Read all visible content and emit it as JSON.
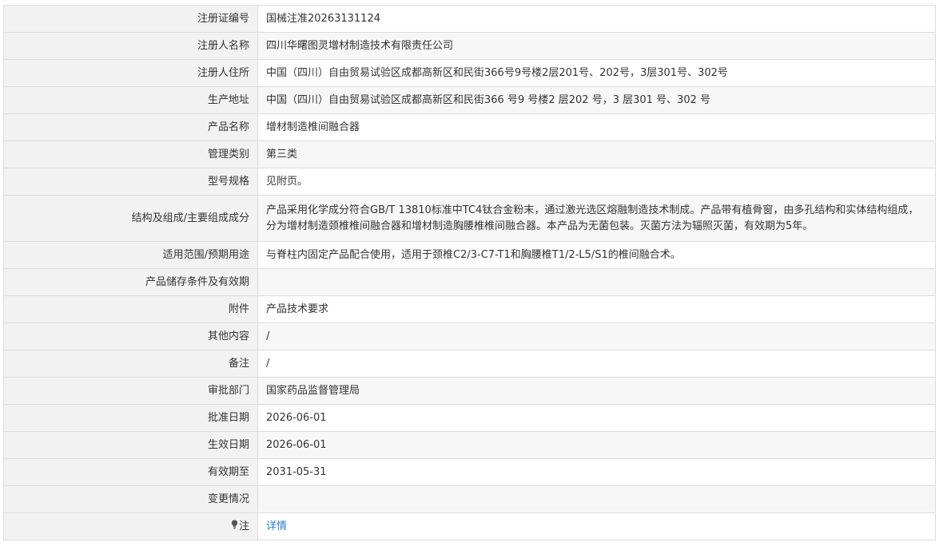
{
  "rows": [
    {
      "label": "注册证编号",
      "value": "国械注准20263131124"
    },
    {
      "label": "注册人名称",
      "value": "四川华曙图灵增材制造技术有限责任公司"
    },
    {
      "label": "注册人住所",
      "value": "中国（四川）自由贸易试验区成都高新区和民街366号9号楼2层201号、202号，3层301号、302号"
    },
    {
      "label": "生产地址",
      "value": "中国（四川）自由贸易试验区成都高新区和民街366 号9 号楼2 层202 号，3 层301 号、302 号"
    },
    {
      "label": "产品名称",
      "value": "增材制造椎间融合器"
    },
    {
      "label": "管理类别",
      "value": "第三类"
    },
    {
      "label": "型号规格",
      "value": "见附页。"
    },
    {
      "label": "结构及组成/主要组成成分",
      "value": "产品采用化学成分符合GB/T 13810标准中TC4钛合金粉末，通过激光选区熔融制造技术制成。产品带有植骨窗，由多孔结构和实体结构组成，分为增材制造颈椎椎间融合器和增材制造胸腰椎椎间融合器。本产品为无菌包装。灭菌方法为辐照灭菌，有效期为5年。"
    },
    {
      "label": "适用范围/预期用途",
      "value": "与脊柱内固定产品配合使用，适用于颈椎C2/3-C7-T1和胸腰椎T1/2-L5/S1的椎间融合术。"
    },
    {
      "label": "产品储存条件及有效期",
      "value": ""
    },
    {
      "label": "附件",
      "value": "产品技术要求"
    },
    {
      "label": "其他内容",
      "value": "/"
    },
    {
      "label": "备注",
      "value": "/"
    },
    {
      "label": "审批部门",
      "value": "国家药品监督管理局"
    },
    {
      "label": "批准日期",
      "value": "2026-06-01"
    },
    {
      "label": "生效日期",
      "value": "2026-06-01"
    },
    {
      "label": "有效期至",
      "value": "2031-05-31"
    },
    {
      "label": "变更情况",
      "value": ""
    }
  ],
  "note": {
    "icon": "lightbulb-icon",
    "label": "注",
    "link_text": "详情"
  },
  "colors": {
    "label_bg": "#f2f2f2",
    "border": "#dcdcdc",
    "link": "#2b7fd1",
    "text": "#333333"
  }
}
